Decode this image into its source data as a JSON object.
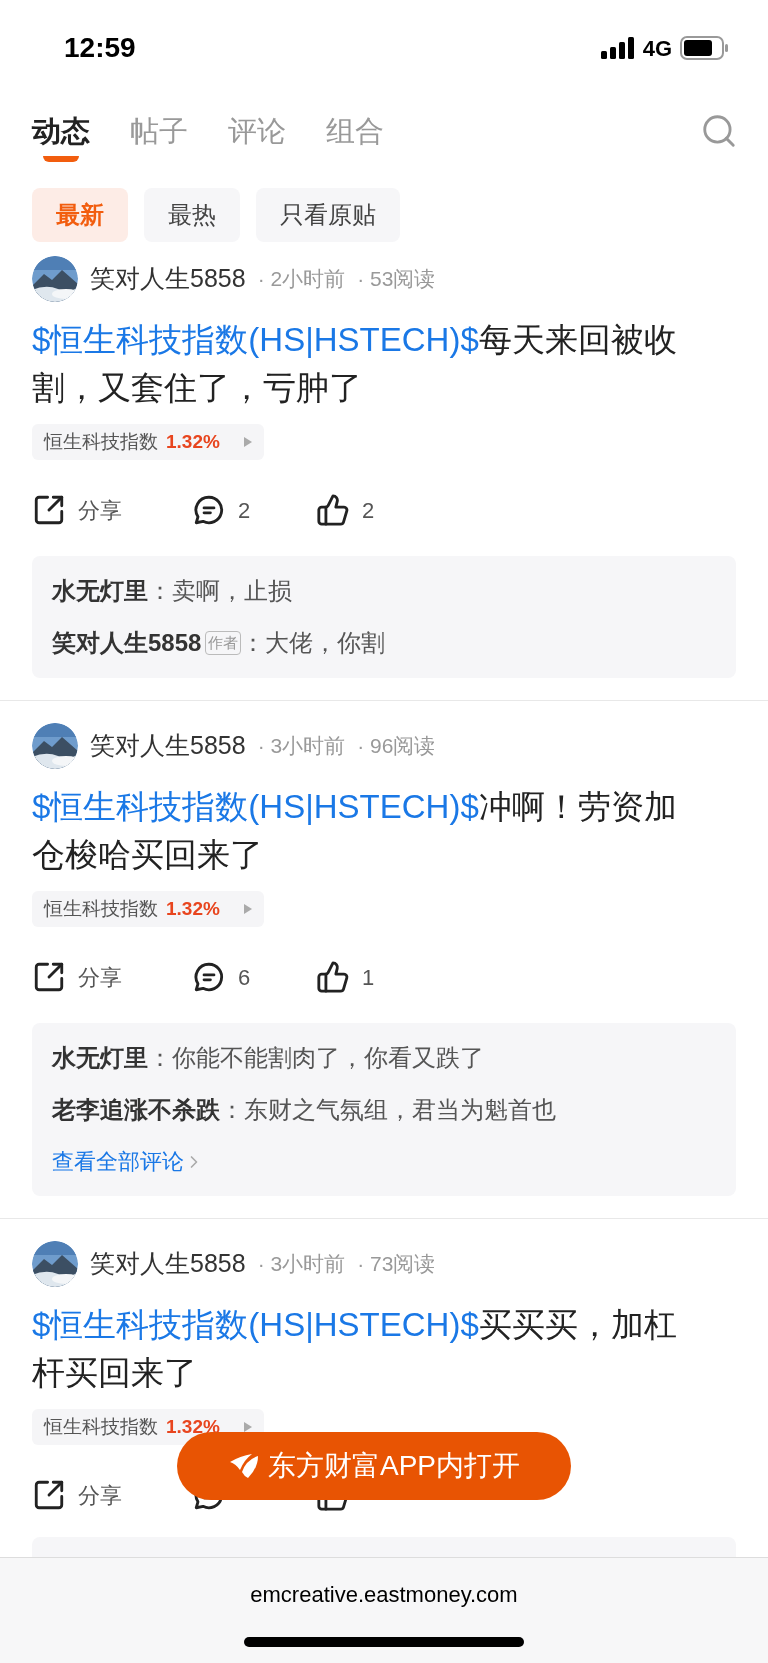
{
  "status_bar": {
    "time": "12:59",
    "network": "4G"
  },
  "tabs": [
    {
      "label": "动态",
      "selected": true
    },
    {
      "label": "帖子",
      "selected": false
    },
    {
      "label": "评论",
      "selected": false
    },
    {
      "label": "组合",
      "selected": false
    }
  ],
  "filters": [
    {
      "label": "最新",
      "selected": true
    },
    {
      "label": "最热",
      "selected": false
    },
    {
      "label": "只看原贴",
      "selected": false
    }
  ],
  "posts": [
    {
      "author": "笑对人生5858",
      "time": "· 2小时前",
      "reads": "· 53阅读",
      "title_link": "$恒生科技指数(HS|HSTECH)$",
      "title_text": "每天来回被收割，又套住了，亏肿了",
      "stock": {
        "name": "恒生科技指数",
        "change": "1.32%"
      },
      "share": "分享",
      "comment_count": "2",
      "like_count": "2",
      "comments": [
        {
          "author": "水无灯里",
          "colon": "：",
          "text": "卖啊，止损"
        },
        {
          "author": "笑对人生5858",
          "badge": "作者",
          "colon": "：",
          "text": "大佬，你割"
        }
      ]
    },
    {
      "author": "笑对人生5858",
      "time": "· 3小时前",
      "reads": "· 96阅读",
      "title_link": "$恒生科技指数(HS|HSTECH)$",
      "title_text": "冲啊！劳资加仓梭哈买回来了",
      "stock": {
        "name": "恒生科技指数",
        "change": "1.32%"
      },
      "share": "分享",
      "comment_count": "6",
      "like_count": "1",
      "comments": [
        {
          "author": "水无灯里",
          "colon": "：",
          "text": "你能不能割肉了，你看又跌了"
        },
        {
          "author": "老李追涨不杀跌",
          "colon": "：",
          "text": "东财之气氛组，君当为魁首也"
        }
      ],
      "more_link": "查看全部评论"
    },
    {
      "author": "笑对人生5858",
      "time": "· 3小时前",
      "reads": "· 73阅读",
      "title_link": "$恒生科技指数(HS|HSTECH)$",
      "title_text": "买买买，加杠杆买回来了",
      "stock": {
        "name": "恒生科技指数",
        "change": "1.32%"
      },
      "share": "分享"
    }
  ],
  "open_app_button": "东方财富APP内打开",
  "browser_bar": {
    "url": "emcreative.eastmoney.com"
  }
}
